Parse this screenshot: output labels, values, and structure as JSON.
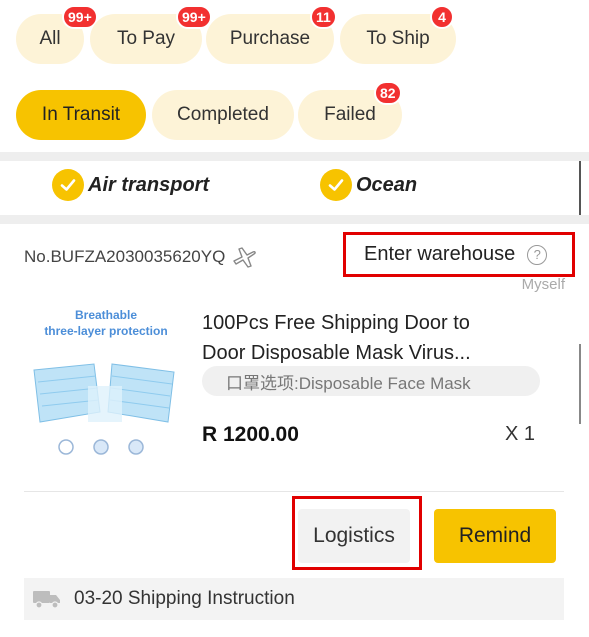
{
  "tabs": {
    "row1": [
      {
        "label": "All",
        "badge": "99+"
      },
      {
        "label": "To Pay",
        "badge": "99+"
      },
      {
        "label": "Purchase",
        "badge": "11"
      },
      {
        "label": "To Ship",
        "badge": "4"
      }
    ],
    "row2": [
      {
        "label": "In Transit",
        "badge": ""
      },
      {
        "label": "Completed",
        "badge": ""
      },
      {
        "label": "Failed",
        "badge": "82"
      }
    ],
    "active": "In Transit"
  },
  "transport": {
    "options": [
      {
        "label": "Air transport",
        "checked": true
      },
      {
        "label": "Ocean",
        "checked": true
      }
    ]
  },
  "order": {
    "number": "No.BUFZA2030035620YQ",
    "status": "Enter warehouse",
    "help_icon": "?",
    "owner": "Myself",
    "image_text": {
      "line1": "Breathable",
      "line2": "three-layer protection"
    },
    "product_title_line1": "100Pcs Free Shipping Door to",
    "product_title_line2": "Door Disposable Mask Virus...",
    "spec": "口罩选项:Disposable Face Mask",
    "price": "R 1200.00",
    "quantity": "X 1",
    "buttons": {
      "logistics": "Logistics",
      "remind": "Remind"
    },
    "shipping_note": "03-20 Shipping Instruction"
  },
  "colors": {
    "accent": "#f7c300",
    "pill_bg": "#fdf3d7",
    "badge": "#f23030",
    "highlight": "#e10000"
  }
}
